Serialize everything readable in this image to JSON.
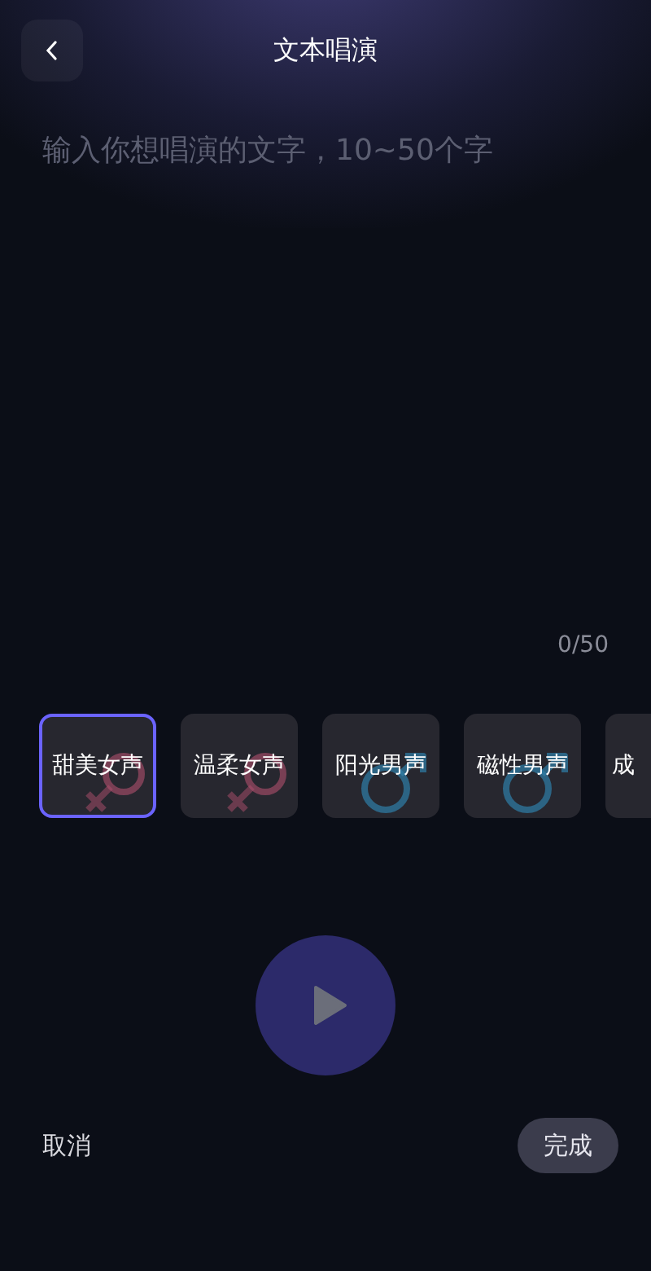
{
  "header": {
    "title": "文本唱演"
  },
  "text_input": {
    "placeholder": "输入你想唱演的文字，10~50个字",
    "counter": "0/50"
  },
  "voices": [
    {
      "label": "甜美女声",
      "kind": "female",
      "selected": true
    },
    {
      "label": "温柔女声",
      "kind": "female",
      "selected": false
    },
    {
      "label": "阳光男声",
      "kind": "male",
      "selected": false
    },
    {
      "label": "磁性男声",
      "kind": "male",
      "selected": false
    },
    {
      "label": "成",
      "kind": "other",
      "selected": false
    }
  ],
  "footer": {
    "cancel": "取消",
    "done": "完成"
  }
}
